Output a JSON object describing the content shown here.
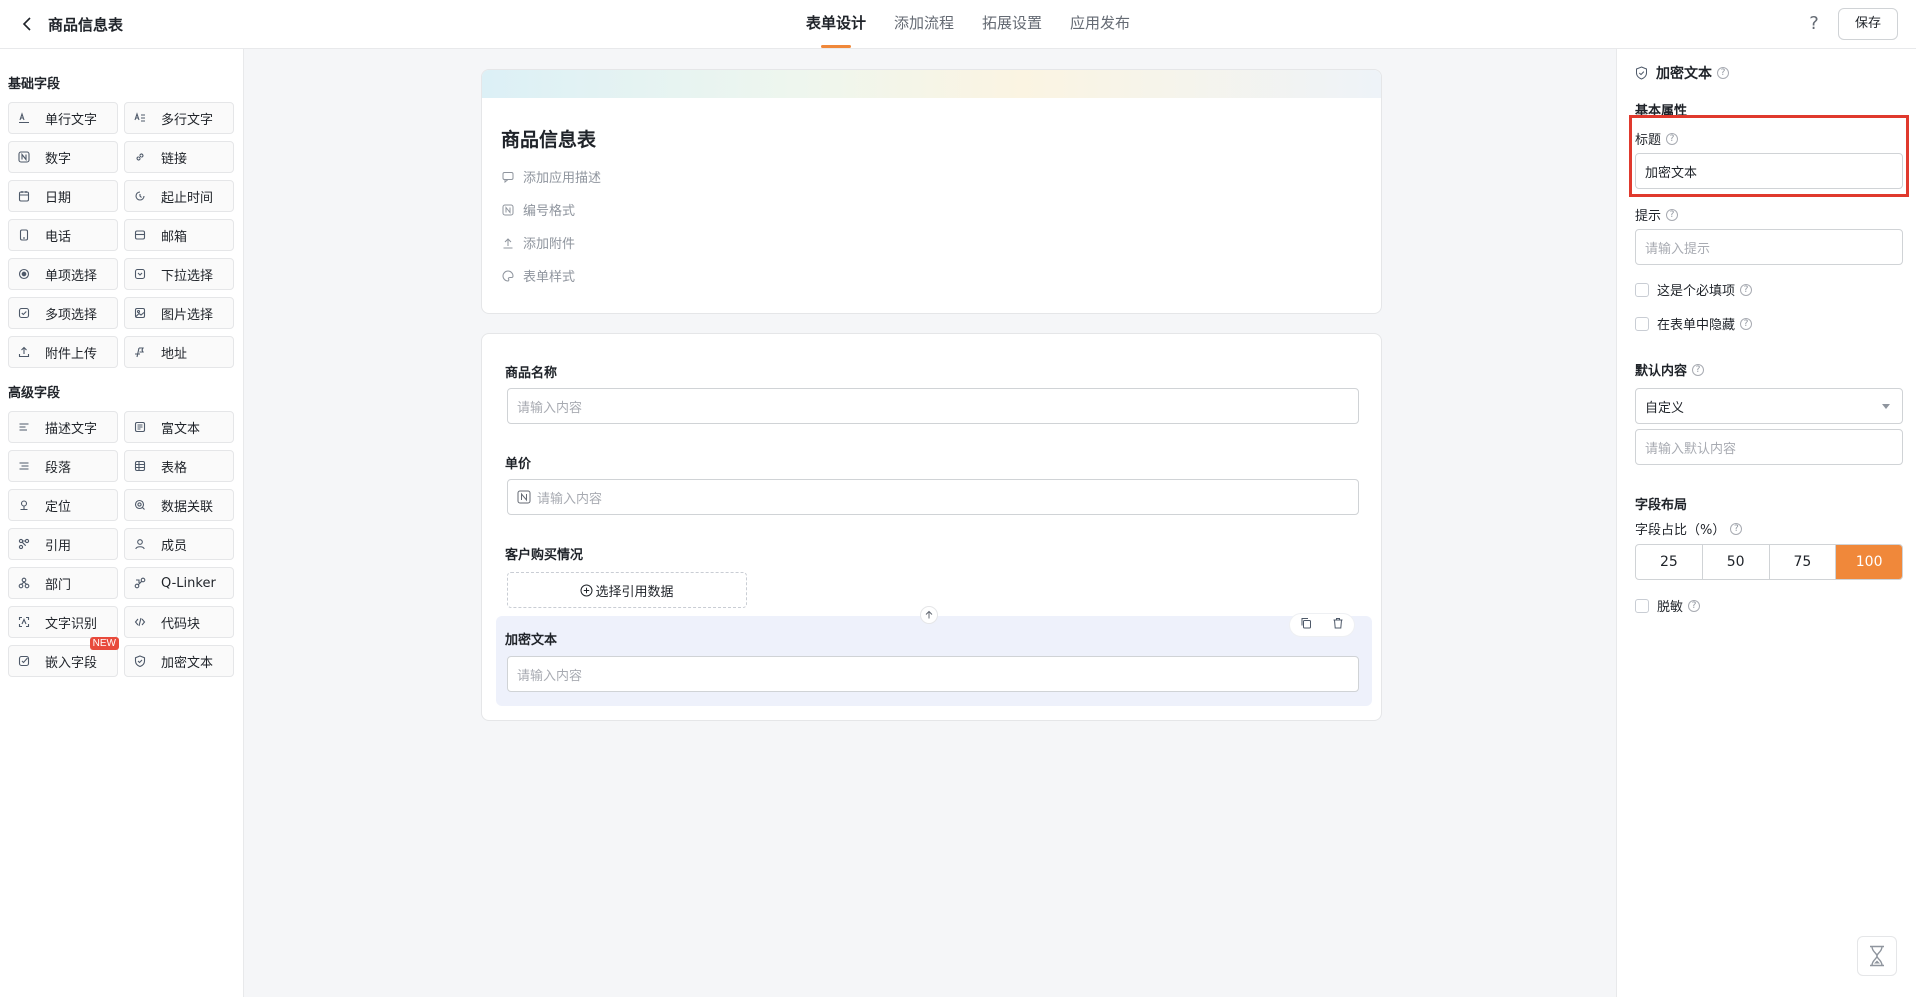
{
  "header": {
    "app_title": "商品信息表",
    "tabs": [
      {
        "label": "表单设计",
        "active": true
      },
      {
        "label": "添加流程",
        "active": false
      },
      {
        "label": "拓展设置",
        "active": false
      },
      {
        "label": "应用发布",
        "active": false
      }
    ],
    "help": "?",
    "save_label": "保存"
  },
  "palette": {
    "basic_title": "基础字段",
    "basic_fields": [
      {
        "label": "单行文字",
        "icon": "single-line-text-icon"
      },
      {
        "label": "多行文字",
        "icon": "multi-line-text-icon"
      },
      {
        "label": "数字",
        "icon": "number-icon"
      },
      {
        "label": "链接",
        "icon": "link-icon"
      },
      {
        "label": "日期",
        "icon": "calendar-icon"
      },
      {
        "label": "起止时间",
        "icon": "time-range-icon"
      },
      {
        "label": "电话",
        "icon": "phone-icon"
      },
      {
        "label": "邮箱",
        "icon": "mail-icon"
      },
      {
        "label": "单项选择",
        "icon": "radio-icon"
      },
      {
        "label": "下拉选择",
        "icon": "dropdown-icon"
      },
      {
        "label": "多项选择",
        "icon": "checkbox-icon"
      },
      {
        "label": "图片选择",
        "icon": "image-icon"
      },
      {
        "label": "附件上传",
        "icon": "upload-icon"
      },
      {
        "label": "地址",
        "icon": "address-icon"
      }
    ],
    "advanced_title": "高级字段",
    "advanced_fields": [
      {
        "label": "描述文字",
        "icon": "description-icon"
      },
      {
        "label": "富文本",
        "icon": "rich-text-icon"
      },
      {
        "label": "段落",
        "icon": "paragraph-icon"
      },
      {
        "label": "表格",
        "icon": "table-icon"
      },
      {
        "label": "定位",
        "icon": "location-icon"
      },
      {
        "label": "数据关联",
        "icon": "data-link-icon"
      },
      {
        "label": "引用",
        "icon": "reference-icon"
      },
      {
        "label": "成员",
        "icon": "member-icon"
      },
      {
        "label": "部门",
        "icon": "department-icon"
      },
      {
        "label": "Q-Linker",
        "icon": "q-linker-icon"
      },
      {
        "label": "文字识别",
        "icon": "ocr-icon"
      },
      {
        "label": "代码块",
        "icon": "code-icon"
      },
      {
        "label": "嵌入字段",
        "icon": "embed-icon",
        "badge": "NEW"
      },
      {
        "label": "加密文本",
        "icon": "shield-icon"
      }
    ]
  },
  "form": {
    "title": "商品信息表",
    "meta": [
      {
        "label": "添加应用描述",
        "icon": "comment-icon"
      },
      {
        "label": "编号格式",
        "icon": "number-format-icon"
      },
      {
        "label": "添加附件",
        "icon": "attachment-icon"
      },
      {
        "label": "表单样式",
        "icon": "palette-icon"
      }
    ],
    "fields": {
      "product_name": {
        "label": "商品名称",
        "placeholder": "请输入内容"
      },
      "unit_price": {
        "label": "单价",
        "placeholder": "请输入内容"
      },
      "purchase": {
        "label": "客户购买情况",
        "button": "选择引用数据"
      },
      "encrypted": {
        "label": "加密文本",
        "placeholder": "请输入内容"
      }
    }
  },
  "panel": {
    "heading": "加密文本",
    "basic_title": "基本属性",
    "title_label": "标题",
    "title_value": "加密文本",
    "hint_label": "提示",
    "hint_placeholder": "请输入提示",
    "required_label": "这是个必填项",
    "hidden_label": "在表单中隐藏",
    "default_label": "默认内容",
    "default_select": "自定义",
    "default_placeholder": "请输入默认内容",
    "layout_title": "字段布局",
    "ratio_label": "字段占比（%）",
    "ratio_options": [
      "25",
      "50",
      "75",
      "100"
    ],
    "ratio_selected": "100",
    "mask_label": "脱敏"
  },
  "colors": {
    "accent": "#f0883a",
    "highlight": "#e0392d",
    "selected_bg": "#eef1fb"
  }
}
